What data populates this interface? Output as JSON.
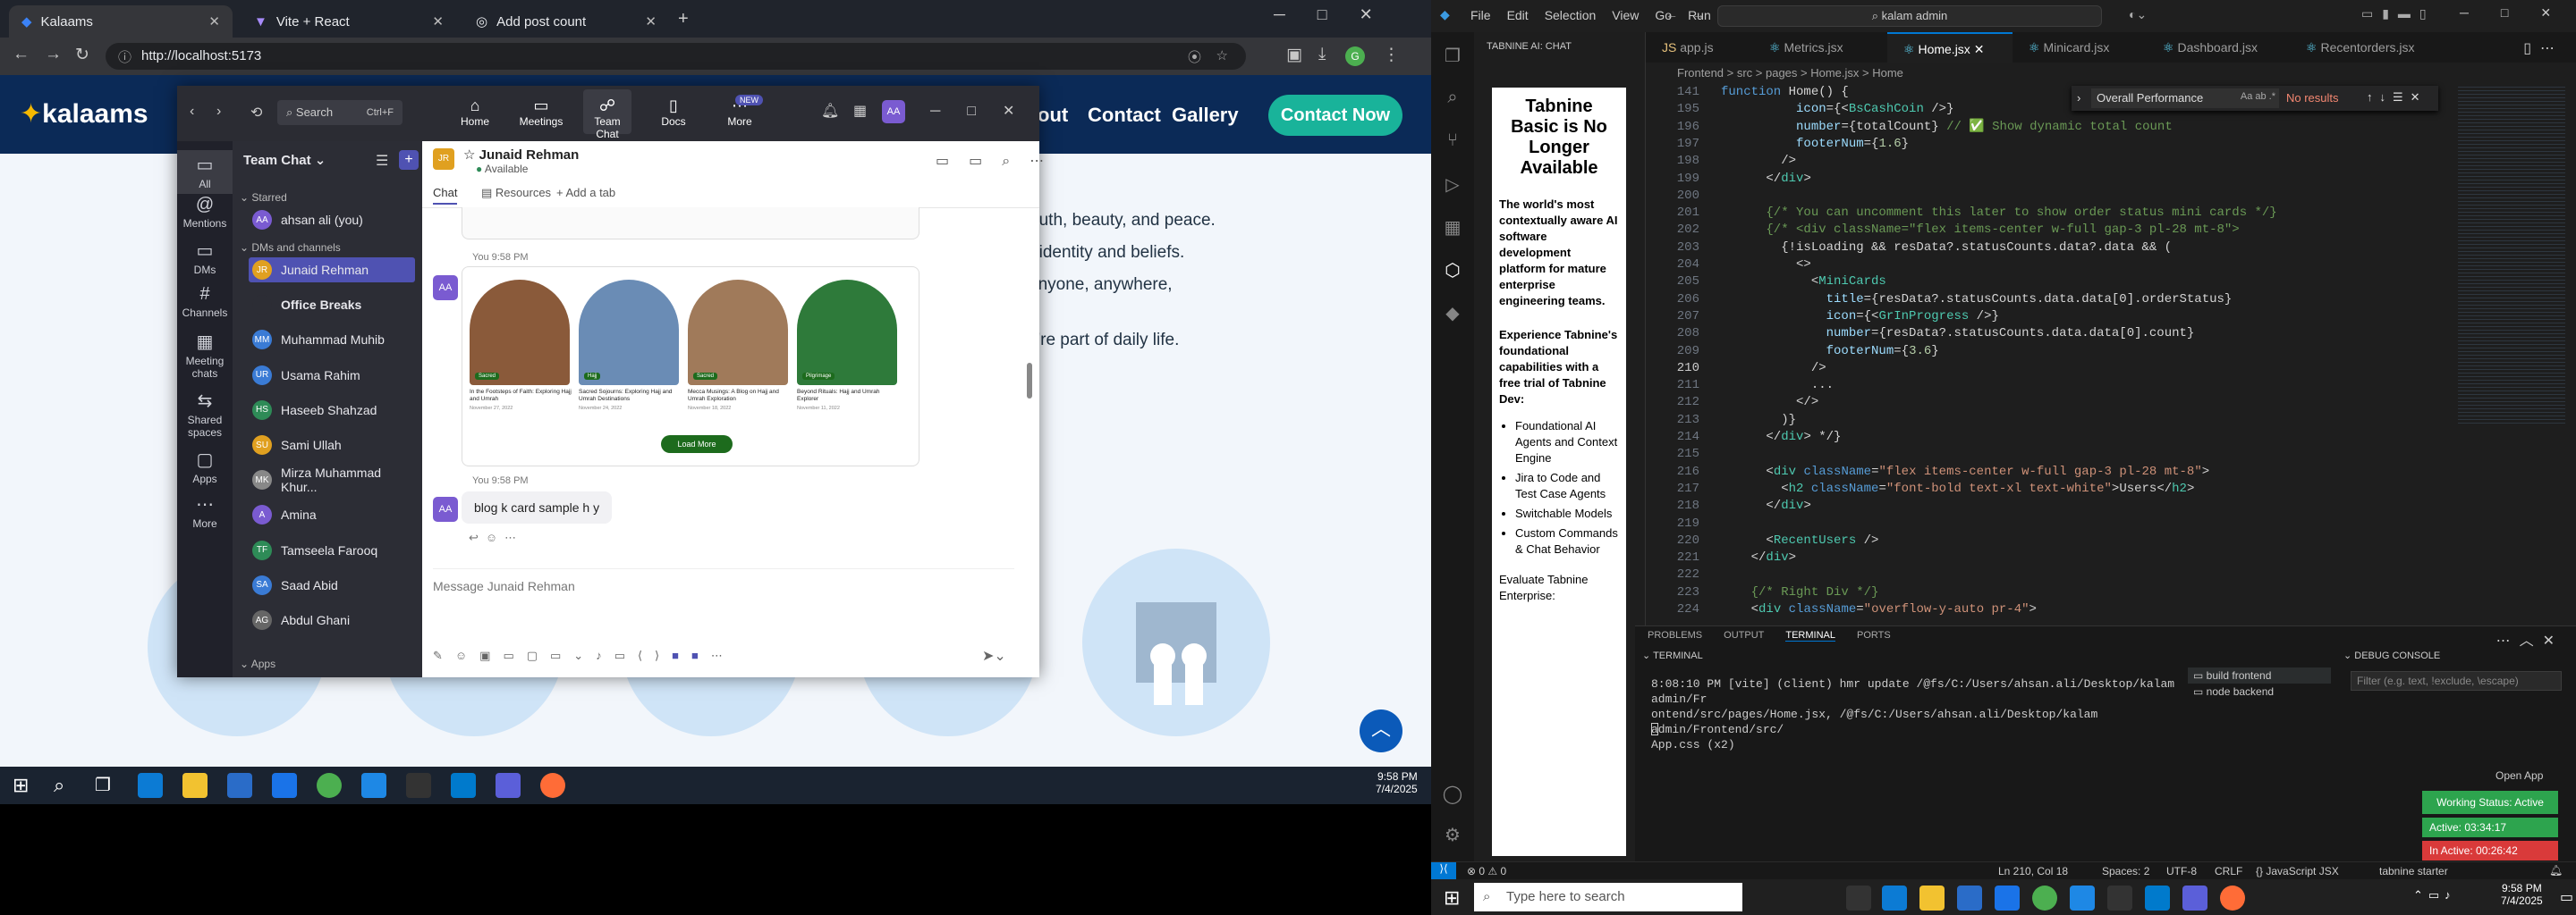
{
  "chrome": {
    "tabs": [
      {
        "label": "Kalaams"
      },
      {
        "label": "Vite + React"
      },
      {
        "label": "Add post count"
      }
    ],
    "url": "http://localhost:5173"
  },
  "site": {
    "logo": "kalaams",
    "nav": [
      "out",
      "Contact",
      "Gallery"
    ],
    "contact_button": "Contact Now",
    "paragraph_lines": [
      "truth, beauty, and peace.",
      "r identity and beliefs.",
      "anyone, anywhere,",
      "y're part of daily life."
    ]
  },
  "teams": {
    "search_placeholder": "Search",
    "search_shortcut": "Ctrl+F",
    "top_nav": [
      {
        "label": "Home"
      },
      {
        "label": "Meetings"
      },
      {
        "label": "Team Chat"
      },
      {
        "label": "Docs"
      },
      {
        "label": "More"
      }
    ],
    "new_badge": "NEW",
    "user_initials": "AA",
    "rail": [
      {
        "label": "All"
      },
      {
        "label": "Mentions"
      },
      {
        "label": "DMs"
      },
      {
        "label": "Channels"
      },
      {
        "label": "Meeting chats"
      },
      {
        "label": "Shared spaces"
      },
      {
        "label": "Apps"
      },
      {
        "label": "More"
      }
    ],
    "list_title": "Team Chat",
    "sections": {
      "starred": "Starred",
      "dms": "DMs and channels",
      "apps": "Apps"
    },
    "starred": [
      {
        "name": "ahsan ali (you)",
        "initials": "AA",
        "color": "#7a5bd1"
      }
    ],
    "contacts": [
      {
        "name": "Junaid Rehman",
        "initials": "JR",
        "color": "#e0a020",
        "selected": true
      },
      {
        "name": "Office Breaks",
        "initials": "",
        "color": "#2c2d35",
        "bold": true
      },
      {
        "name": "Muhammad Muhib",
        "initials": "MM",
        "color": "#3a7bd5"
      },
      {
        "name": "Usama Rahim",
        "initials": "UR",
        "color": "#3a7bd5"
      },
      {
        "name": "Haseeb Shahzad",
        "initials": "HS",
        "color": "#2e8b57"
      },
      {
        "name": "Sami Ullah",
        "initials": "SU",
        "color": "#e0a020"
      },
      {
        "name": "Mirza Muhammad Khur...",
        "initials": "MK",
        "color": "#888"
      },
      {
        "name": "Amina",
        "initials": "A",
        "color": "#7a5bd1"
      },
      {
        "name": "Tamseela Farooq",
        "initials": "TF",
        "color": "#2e8b57"
      },
      {
        "name": "Saad Abid",
        "initials": "SA",
        "color": "#3a7bd5"
      },
      {
        "name": "Abdul Ghani",
        "initials": "AG",
        "color": "#666"
      }
    ],
    "chat": {
      "contact_initials": "JR",
      "contact_name": "Junaid Rehman",
      "status": "Available",
      "tabs": [
        "Chat",
        "Resources",
        "+ Add a tab"
      ],
      "messages": [
        {
          "time": "You 9:58 PM",
          "avatar": "AA",
          "kind": "image",
          "cards": [
            {
              "title": "In the Footsteps of Faith: Exploring Hajj and Umrah",
              "tag": "Sacred",
              "date": "November 27, 2022"
            },
            {
              "title": "Sacred Sojourns: Exploring Hajj and Umrah Destinations",
              "tag": "Hajj",
              "date": "November 24, 2022"
            },
            {
              "title": "Mecca Musings: A Blog on Hajj and Umrah Exploration",
              "tag": "Sacred",
              "date": "November 18, 2022"
            },
            {
              "title": "Beyond Rituals: Hajj and Umrah Explorer",
              "tag": "Pilgrimage",
              "date": "November 11, 2022"
            }
          ],
          "button": "Load More"
        },
        {
          "time": "You 9:58 PM",
          "avatar": "AA",
          "kind": "text",
          "text": "blog k card sample h y"
        }
      ],
      "composer_placeholder": "Message Junaid Rehman"
    }
  },
  "taskbar_left": {
    "time": "9:58 PM",
    "date": "7/4/2025"
  },
  "vscode": {
    "menu": [
      "File",
      "Edit",
      "Selection",
      "View",
      "Go",
      "Run",
      "..."
    ],
    "search": "kalam admin",
    "tabnine_title": "TABNINE AI: CHAT",
    "tabnine": {
      "heading": "Tabnine Basic is No Longer Available",
      "para": "The world's most contextually aware AI software development platform for mature enterprise engineering teams.",
      "sub": "Experience Tabnine's foundational capabilities with a free trial of Tabnine Dev:",
      "bullets": [
        "Foundational AI Agents and Context Engine",
        "Jira to Code and Test Case Agents",
        "Switchable Models",
        "Custom Commands & Chat Behavior"
      ],
      "footer": "Evaluate Tabnine Enterprise:"
    },
    "tabs": [
      {
        "label": "app.js"
      },
      {
        "label": "Metrics.jsx"
      },
      {
        "label": "Home.jsx",
        "active": true
      },
      {
        "label": "Minicard.jsx"
      },
      {
        "label": "Dashboard.jsx"
      },
      {
        "label": "Recentorders.jsx"
      }
    ],
    "breadcrumb": "Frontend > src > pages > Home.jsx > Home",
    "find": {
      "query": "Overall Performance",
      "result": "No results"
    },
    "code_lines": [
      {
        "n": "141",
        "t": "function Home() {"
      },
      {
        "n": "195",
        "t": "          icon={<BsCashCoin />}"
      },
      {
        "n": "196",
        "t": "          number={totalCount} // ✅ Show dynamic total count"
      },
      {
        "n": "197",
        "t": "          footerNum={1.6}"
      },
      {
        "n": "198",
        "t": "        />"
      },
      {
        "n": "199",
        "t": "      </div>"
      },
      {
        "n": "200",
        "t": ""
      },
      {
        "n": "201",
        "t": "      {/* You can uncomment this later to show order status mini cards */}"
      },
      {
        "n": "202",
        "t": "      {/* <div className=\"flex items-center w-full gap-3 pl-28 mt-8\">"
      },
      {
        "n": "203",
        "t": "        {!isLoading && resData?.statusCounts.data?.data && ("
      },
      {
        "n": "204",
        "t": "          <>"
      },
      {
        "n": "205",
        "t": "            <MiniCards"
      },
      {
        "n": "206",
        "t": "              title={resData?.statusCounts.data.data[0].orderStatus}"
      },
      {
        "n": "207",
        "t": "              icon={<GrInProgress />}"
      },
      {
        "n": "208",
        "t": "              number={resData?.statusCounts.data.data[0].count}"
      },
      {
        "n": "209",
        "t": "              footerNum={3.6}"
      },
      {
        "n": "210",
        "t": "            />"
      },
      {
        "n": "211",
        "t": "            ..."
      },
      {
        "n": "212",
        "t": "          </>"
      },
      {
        "n": "213",
        "t": "        )}"
      },
      {
        "n": "214",
        "t": "      </div> */}"
      },
      {
        "n": "215",
        "t": ""
      },
      {
        "n": "216",
        "t": "      <div className=\"flex items-center w-full gap-3 pl-28 mt-8\">"
      },
      {
        "n": "217",
        "t": "        <h2 className=\"font-bold text-xl text-white\">Users</h2>"
      },
      {
        "n": "218",
        "t": "      </div>"
      },
      {
        "n": "219",
        "t": ""
      },
      {
        "n": "220",
        "t": "      <RecentUsers />"
      },
      {
        "n": "221",
        "t": "    </div>"
      },
      {
        "n": "222",
        "t": ""
      },
      {
        "n": "223",
        "t": "    {/* Right Div */}"
      },
      {
        "n": "224",
        "t": "    <div className=\"overflow-y-auto pr-4\">"
      }
    ],
    "panel_tabs": [
      "PROBLEMS",
      "OUTPUT",
      "TERMINAL",
      "PORTS"
    ],
    "terminal_label": "TERMINAL",
    "terminal_lines": [
      "8:08:10 PM [vite] (client) hmr update /@fs/C:/Users/ahsan.ali/Desktop/kalam admin/Fr",
      "ontend/src/pages/Home.jsx, /@fs/C:/Users/ahsan.ali/Desktop/kalam admin/Frontend/src/",
      "App.css (x2)"
    ],
    "terminals": [
      {
        "label": "build frontend"
      },
      {
        "label": "node backend"
      }
    ],
    "debug_console": "DEBUG CONSOLE",
    "debug_filter": "Filter (e.g. text, !exclude, \\escape)",
    "open_app": "Open App",
    "working_status": "Working Status: Active",
    "active_time": "Active: 03:34:17",
    "inactive_time": "In Active: 00:26:42",
    "status": {
      "left": "⊗ 0 ⚠ 0",
      "position": "Ln 210, Col 18",
      "spaces": "Spaces: 2",
      "encoding": "UTF-8",
      "eol": "CRLF",
      "lang": "{} JavaScript JSX",
      "tabnine": "tabnine starter"
    },
    "taskbar": {
      "search": "Type here to search",
      "time": "9:58 PM",
      "date": "7/4/2025"
    }
  }
}
